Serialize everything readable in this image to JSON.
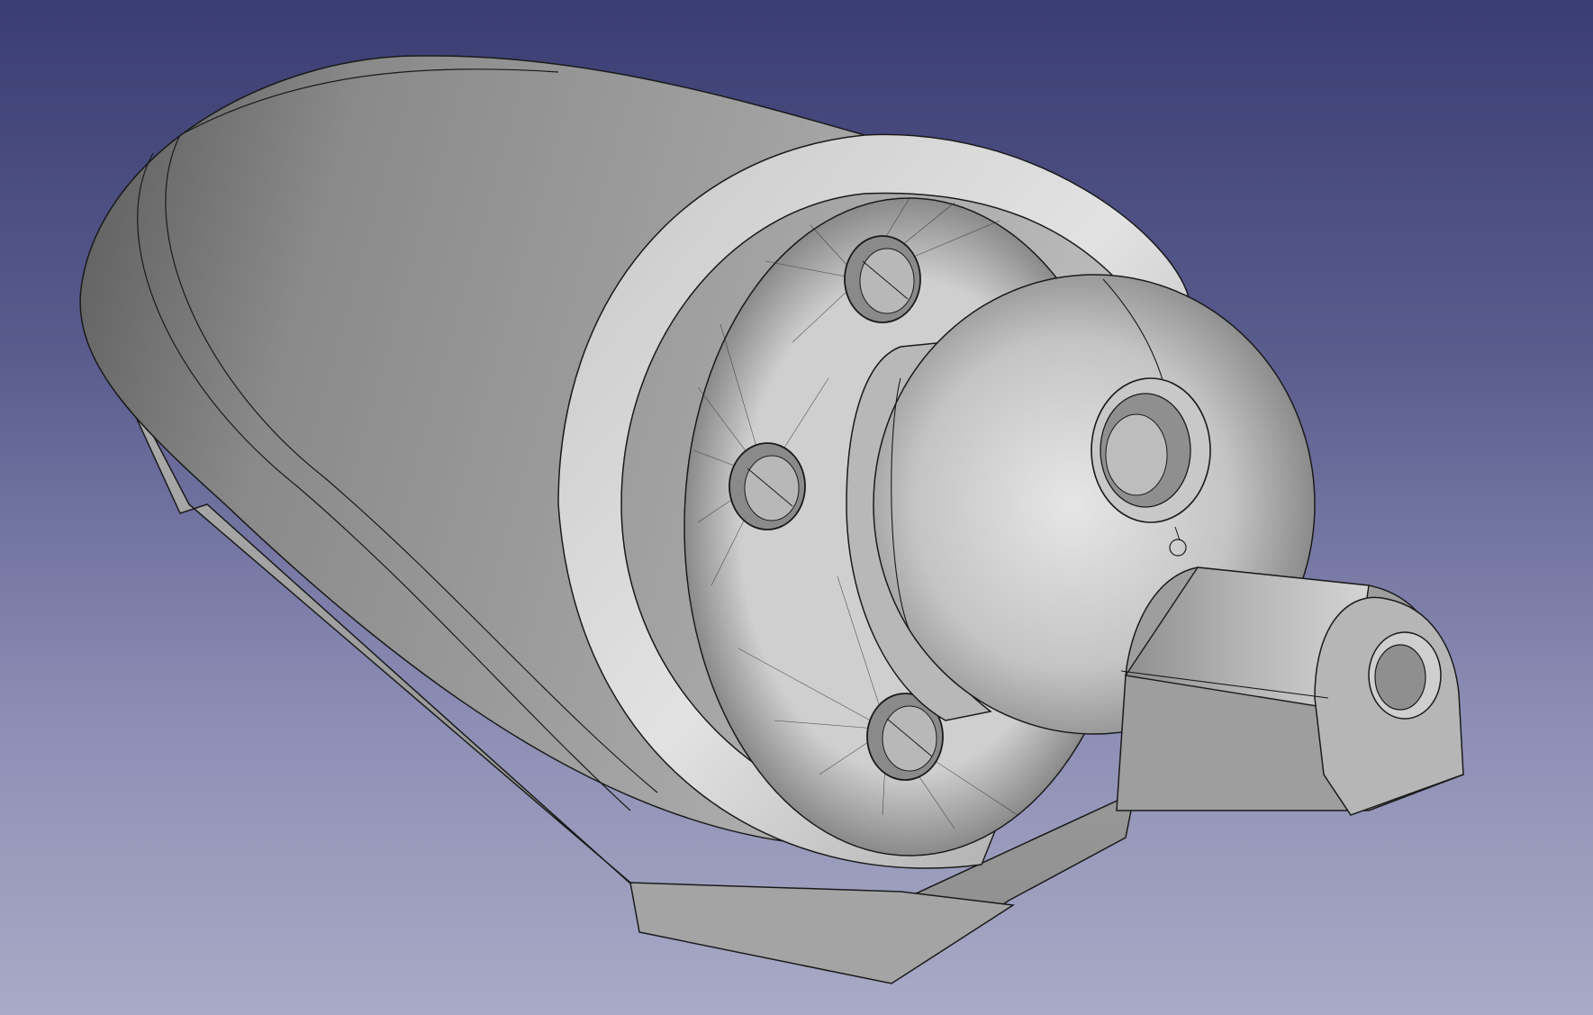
{
  "view": {
    "background_top": "#3a3d72",
    "background_bottom": "#a9aac6",
    "model_fill": "#9a9a9a",
    "model_highlight": "#d8d8d8",
    "edge_color": "#1a1a1a"
  },
  "model": {
    "holes_visible": 3
  }
}
